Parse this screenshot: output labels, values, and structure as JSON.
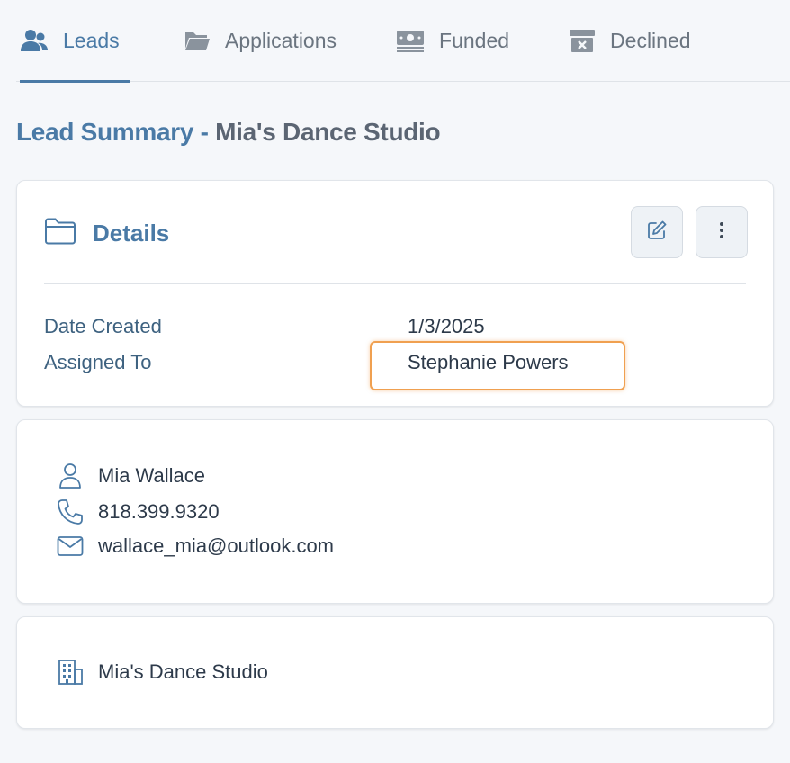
{
  "tabs": [
    {
      "label": "Leads",
      "icon": "users-icon",
      "active": true
    },
    {
      "label": "Applications",
      "icon": "folder-icon",
      "active": false
    },
    {
      "label": "Funded",
      "icon": "money-icon",
      "active": false
    },
    {
      "label": "Declined",
      "icon": "archive-x-icon",
      "active": false
    }
  ],
  "page": {
    "title_prefix": "Lead Summary",
    "title_separator": " - ",
    "title_name": "Mia's Dance Studio"
  },
  "details": {
    "heading": "Details",
    "heading_icon": "folder-outline-icon",
    "rows": [
      {
        "label": "Date Created",
        "value": "1/3/2025"
      },
      {
        "label": "Assigned To",
        "value": "Stephanie Powers"
      }
    ]
  },
  "contact": {
    "name": "Mia Wallace",
    "phone": "818.399.9320",
    "email": "wallace_mia@outlook.com"
  },
  "business": {
    "name": "Mia's Dance Studio"
  },
  "colors": {
    "accent": "#4a7aa6",
    "highlight": "#f0a050",
    "background": "#f5f7fa"
  }
}
